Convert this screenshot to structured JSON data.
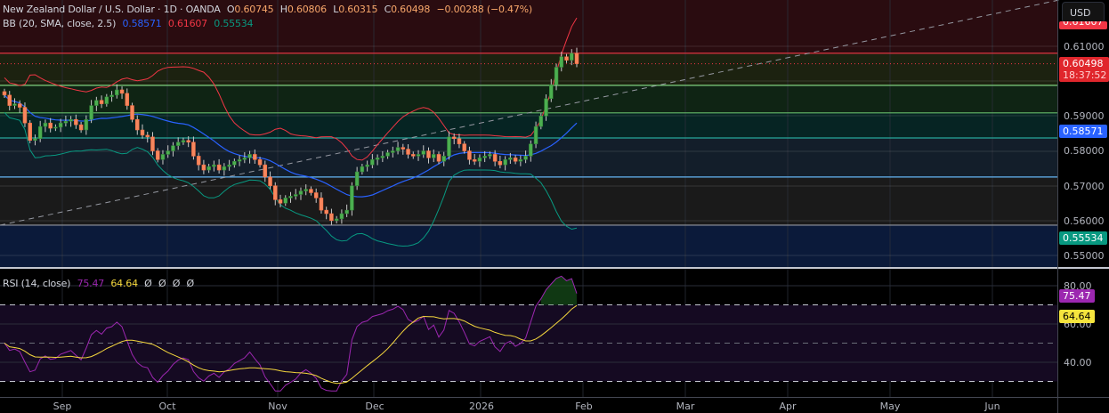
{
  "header": {
    "symbol": "New Zealand Dollar / U.S. Dollar · 1D · OANDA",
    "open_label": "O",
    "open": "0.60745",
    "high_label": "H",
    "high": "0.60806",
    "low_label": "L",
    "low": "0.60315",
    "close_label": "C",
    "close": "0.60498",
    "change": "−0.00288 (−0.47%)"
  },
  "bb": {
    "title": "BB (20, SMA, close, 2.5)",
    "basis": "0.58571",
    "upper": "0.61607",
    "lower": "0.55534"
  },
  "rsi": {
    "title": "RSI (14, close)",
    "value": "75.47",
    "ma": "64.64",
    "extras": [
      "Ø",
      "Ø",
      "Ø",
      "Ø"
    ]
  },
  "currency_button": "USD",
  "price_axis": [
    "0.61000",
    "0.59000",
    "0.58000",
    "0.57000",
    "0.56000",
    "0.55000"
  ],
  "price_tags": {
    "upper": "0.61607",
    "last": "0.60498",
    "countdown": "18:37:52",
    "basis": "0.58571",
    "lower": "0.55534"
  },
  "rsi_axis": [
    "80.00",
    "60.00",
    "40.00"
  ],
  "rsi_tags": {
    "rsi": "75.47",
    "ma": "64.64"
  },
  "time_axis": [
    "Sep",
    "Oct",
    "Nov",
    "Dec",
    "2026",
    "Feb",
    "Mar",
    "Apr",
    "May",
    "Jun"
  ],
  "colors": {
    "up": "#4caf50",
    "down": "#f7875e",
    "basis": "#2962ff",
    "upper": "#f23645",
    "lower": "#089981",
    "rsi": "#9c27b0",
    "rsi_ma": "#f5d73d"
  },
  "chart_data": {
    "type": "candlestick",
    "title": "NZD/USD 1D",
    "ylim": [
      0.545,
      0.62
    ],
    "closes": [
      0.596,
      0.593,
      0.5935,
      0.5925,
      0.588,
      0.583,
      0.5835,
      0.587,
      0.588,
      0.5865,
      0.5868,
      0.588,
      0.5885,
      0.589,
      0.5875,
      0.586,
      0.589,
      0.593,
      0.5945,
      0.5935,
      0.5955,
      0.596,
      0.5975,
      0.5965,
      0.593,
      0.589,
      0.586,
      0.5845,
      0.584,
      0.58,
      0.5775,
      0.579,
      0.58,
      0.5815,
      0.5825,
      0.583,
      0.5825,
      0.5785,
      0.576,
      0.5745,
      0.5755,
      0.576,
      0.5745,
      0.5755,
      0.576,
      0.577,
      0.5775,
      0.578,
      0.579,
      0.5775,
      0.576,
      0.5725,
      0.57,
      0.566,
      0.565,
      0.5665,
      0.567,
      0.5675,
      0.5685,
      0.569,
      0.568,
      0.5665,
      0.563,
      0.562,
      0.56,
      0.5605,
      0.562,
      0.563,
      0.57,
      0.574,
      0.5755,
      0.576,
      0.5775,
      0.578,
      0.5785,
      0.5795,
      0.58,
      0.581,
      0.5805,
      0.579,
      0.5785,
      0.579,
      0.58,
      0.578,
      0.579,
      0.577,
      0.5785,
      0.584,
      0.5835,
      0.582,
      0.58,
      0.5775,
      0.577,
      0.578,
      0.5785,
      0.579,
      0.577,
      0.576,
      0.5775,
      0.578,
      0.577,
      0.5775,
      0.5785,
      0.582,
      0.587,
      0.59,
      0.595,
      0.599,
      0.604,
      0.607,
      0.606,
      0.608,
      0.605
    ],
    "zones": [
      0.608,
      0.5988,
      0.5909,
      0.5837,
      0.5725,
      0.5587
    ],
    "rsi_levels": [
      70,
      50,
      30
    ]
  }
}
